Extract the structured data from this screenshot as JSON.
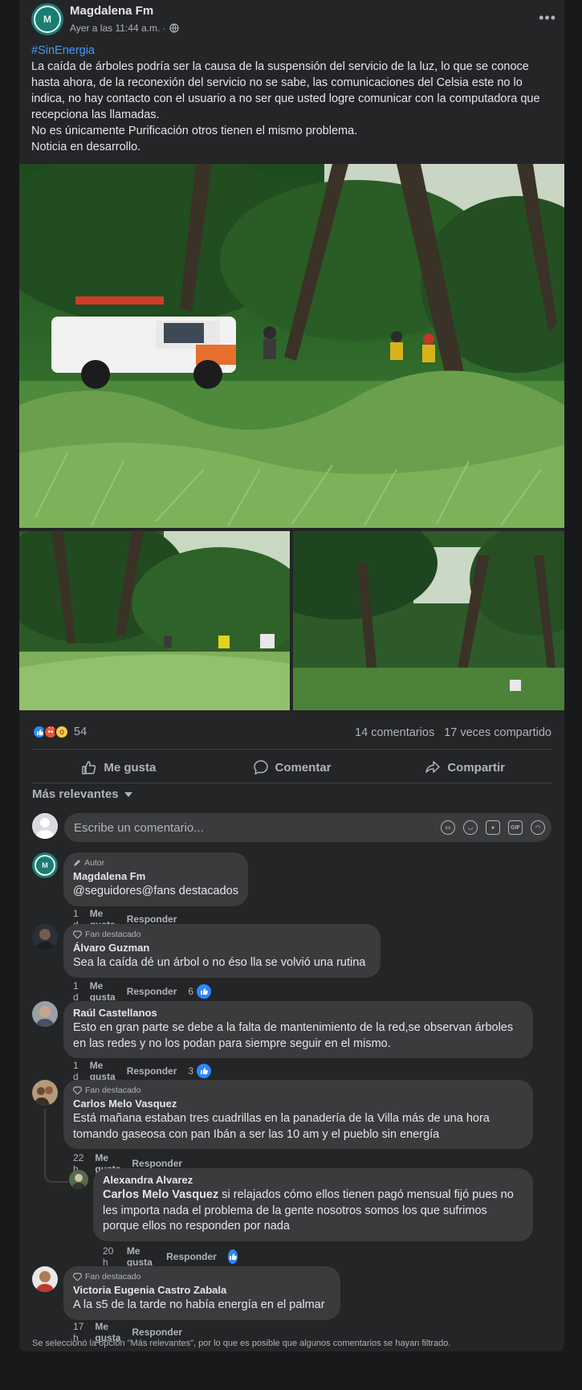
{
  "post": {
    "author": "Magdalena Fm",
    "avatar_text": "M",
    "time": "Ayer a las 11:44 a.m. ·",
    "hashtag": "#SinEnergia",
    "paragraphs": [
      "La caída de árboles podría ser la causa de la suspensión del servicio de la luz, lo que se conoce hasta ahora, de la reconexión del servicio no se sabe, las comunicaciones del Celsia este no lo indica, no hay contacto con el usuario a no ser  que usted logre comunicar con la computadora que recepciona las llamadas.",
      "No es únicamente Purificación otros tienen el mismo problema.",
      "Noticia en desarrollo."
    ],
    "more_icon": "more-dots-icon",
    "privacy_icon": "globe-icon"
  },
  "stats": {
    "reaction_icons": [
      "like-icon",
      "angry-icon",
      "wow-icon"
    ],
    "reaction_count": "54",
    "comments": "14 comentarios",
    "shares": "17 veces compartido"
  },
  "actions": {
    "like": "Me gusta",
    "comment": "Comentar",
    "share": "Compartir"
  },
  "filter": {
    "label": "Más relevantes"
  },
  "composer": {
    "placeholder": "Escribe un comentario..."
  },
  "comments": [
    {
      "badge": "Autor",
      "name": "Magdalena Fm",
      "text": "@seguidores@fans destacados",
      "time": "1 d",
      "like": "Me gusta",
      "reply": "Responder",
      "likes": ""
    },
    {
      "badge": "Fan destacado",
      "name": "Álvaro Guzman",
      "text": "Sea la caída dé un árbol o no éso lla se volvió una rutina",
      "time": "1 d",
      "like": "Me gusta",
      "reply": "Responder",
      "likes": "6"
    },
    {
      "badge": "",
      "name": "Raúl Castellanos",
      "text": "Esto en gran parte se debe a la falta de mantenimiento de la red,se observan árboles en las redes y no los podan para siempre seguir en el mismo.",
      "time": "1 d",
      "like": "Me gusta",
      "reply": "Responder",
      "likes": "3"
    },
    {
      "badge": "Fan destacado",
      "name": "Carlos Melo Vasquez",
      "text": "Está mañana estaban tres cuadrillas en la panadería de la Villa más de una hora tomando gaseosa con pan Ibán a ser las 10 am y el pueblo sin energía",
      "time": "22 h",
      "like": "Me gusta",
      "reply": "Responder",
      "likes": ""
    },
    {
      "badge": "",
      "name": "Alexandra Alvarez",
      "mention": "Carlos Melo Vasquez",
      "text": "si relajados cómo ellos tienen pagó mensual fijó pues no les importa nada el problema de la gente nosotros somos los que sufrimos porque ellos no responden por nada",
      "time": "20 h",
      "like": "Me gusta",
      "reply": "Responder",
      "likes": ""
    },
    {
      "badge": "Fan destacado",
      "name": "Victoria Eugenia Castro Zabala",
      "text": "A la s5 de la tarde no había energía en el palmar",
      "time": "17 h",
      "like": "Me gusta",
      "reply": "Responder",
      "likes": ""
    }
  ],
  "footer": "Se seleccionó la opción \"Más relevantes\", por lo que es posible que algunos comentarios se hayan filtrado.",
  "colors": {
    "page_bg": "#18191a",
    "card_bg": "#242526",
    "bubble_bg": "#3a3b3c",
    "link": "#4599ff",
    "like_blue": "#2d88ff"
  }
}
